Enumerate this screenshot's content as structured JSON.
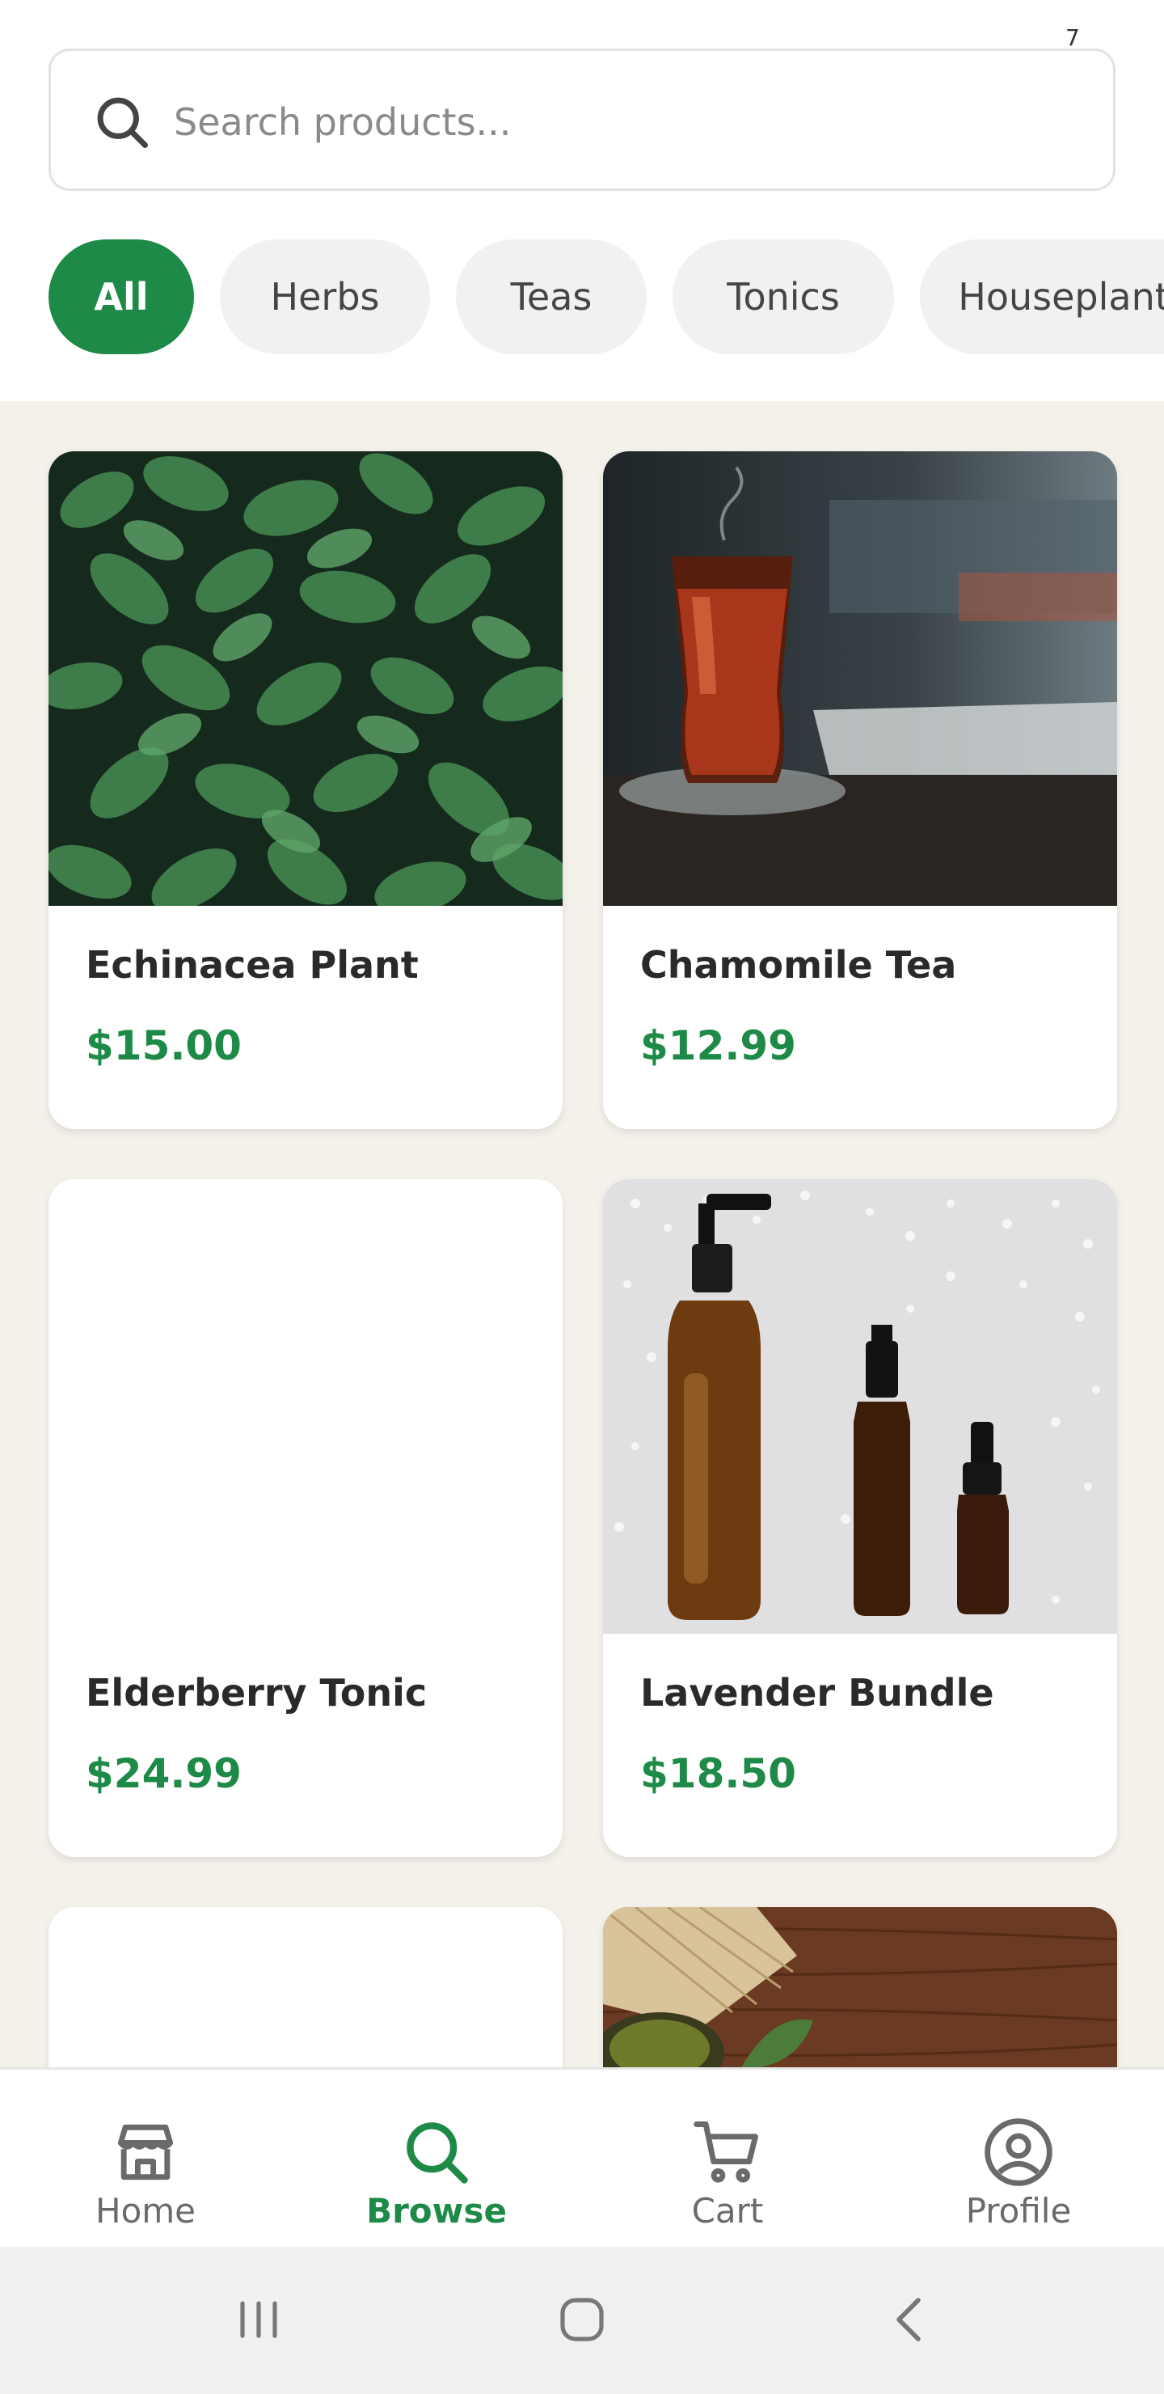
{
  "status": {
    "mark": "7"
  },
  "search": {
    "placeholder": "Search products..."
  },
  "categories": [
    {
      "label": "All",
      "active": true
    },
    {
      "label": "Herbs",
      "active": false
    },
    {
      "label": "Teas",
      "active": false
    },
    {
      "label": "Tonics",
      "active": false
    },
    {
      "label": "Houseplants",
      "active": false
    }
  ],
  "products": [
    {
      "name": "Echinacea Plant",
      "price": "$15.00",
      "image": "green-leaves"
    },
    {
      "name": "Chamomile Tea",
      "price": "$12.99",
      "image": "glass-of-tea"
    },
    {
      "name": "Elderberry Tonic",
      "price": "$24.99",
      "image": "none"
    },
    {
      "name": "Lavender Bundle",
      "price": "$18.50",
      "image": "amber-bottles"
    },
    {
      "name": "",
      "price": "",
      "image": "none"
    },
    {
      "name": "",
      "price": "",
      "image": "wood-and-matcha"
    }
  ],
  "bottom_nav": [
    {
      "label": "Home",
      "icon": "store-icon",
      "active": false
    },
    {
      "label": "Browse",
      "icon": "search-icon",
      "active": true
    },
    {
      "label": "Cart",
      "icon": "cart-icon",
      "active": false
    },
    {
      "label": "Profile",
      "icon": "user-circle-icon",
      "active": false
    }
  ],
  "system_nav": {
    "buttons": [
      "recent-apps-icon",
      "home-circle-icon",
      "back-chevron-icon"
    ]
  },
  "colors": {
    "accent": "#1e8a47",
    "background": "#f4f0ea",
    "chip_inactive": "#f1f1f2"
  }
}
